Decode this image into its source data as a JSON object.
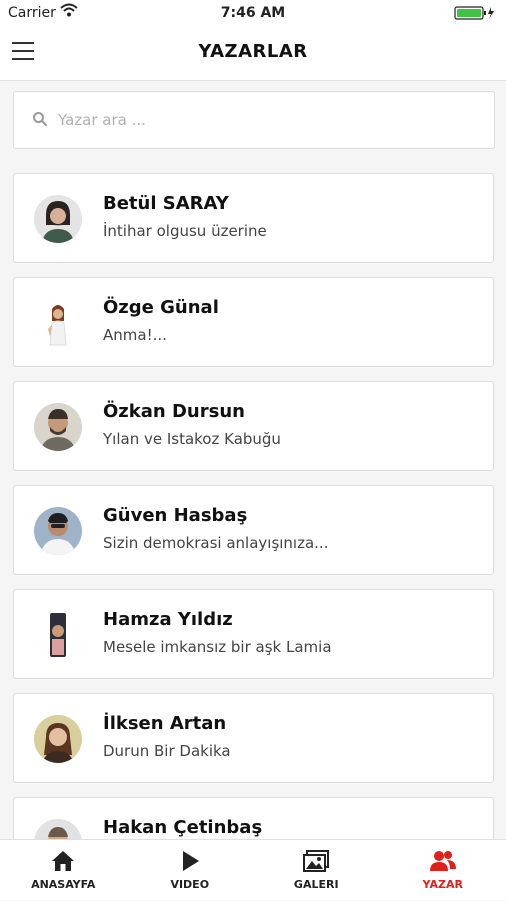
{
  "status_bar": {
    "carrier": "Carrier",
    "time": "7:46 AM"
  },
  "header": {
    "title": "YAZARLAR"
  },
  "search": {
    "placeholder": "Yazar ara ..."
  },
  "authors": [
    {
      "name": "Betül SARAY",
      "latest": "İntihar olgusu üzerine",
      "avatar_color": "#6b5a4e"
    },
    {
      "name": "Özge Günal",
      "latest": "Anma!...",
      "avatar_color": "#c98b6a"
    },
    {
      "name": "Özkan Dursun",
      "latest": "Yılan ve Istakoz Kabuğu",
      "avatar_color": "#7a6a5a"
    },
    {
      "name": "Güven Hasbaş",
      "latest": "Sizin demokrasi anlayışınıza...",
      "avatar_color": "#4a4a4a"
    },
    {
      "name": "Hamza Yıldız",
      "latest": "Mesele imkansız bir aşk Lamia",
      "avatar_color": "#8a6a50"
    },
    {
      "name": "İlksen Artan",
      "latest": "Durun Bir Dakika",
      "avatar_color": "#b08060"
    },
    {
      "name": "Hakan Çetinbaş",
      "latest": "",
      "avatar_color": "#a0a0a0"
    }
  ],
  "tabs": [
    {
      "label": "ANASAYFA",
      "icon": "home-icon",
      "active": false
    },
    {
      "label": "VIDEO",
      "icon": "play-icon",
      "active": false
    },
    {
      "label": "GALERI",
      "icon": "gallery-icon",
      "active": false
    },
    {
      "label": "YAZAR",
      "icon": "authors-icon",
      "active": true
    }
  ],
  "colors": {
    "accent": "#e0201b",
    "background": "#f5f5f5"
  }
}
